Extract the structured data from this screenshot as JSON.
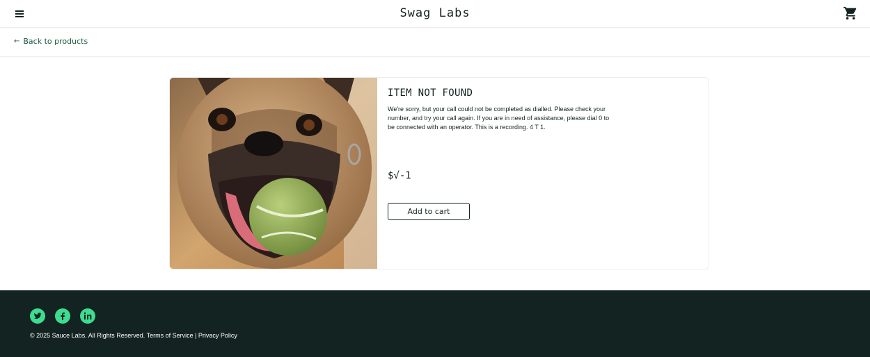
{
  "header": {
    "title": "Swag Labs",
    "menu_icon": "hamburger-menu-icon",
    "cart_icon": "shopping-cart-icon"
  },
  "secondary": {
    "back_label": "Back to products",
    "back_icon": "arrow-left-icon"
  },
  "item": {
    "name": "ITEM NOT FOUND",
    "description": "We're sorry, but your call could not be completed as dialled. Please check your number, and try your call again. If you are in need of assistance, please dial 0 to be connected with an operator. This is a recording. 4 T 1.",
    "price": "$√-1",
    "add_label": "Add to cart",
    "image_icon": "pug-with-tennis-ball-photo"
  },
  "footer": {
    "copyright": "© 2025 Sauce Labs. All Rights Reserved. Terms of Service | Privacy Policy",
    "social": [
      "twitter-icon",
      "facebook-icon",
      "linkedin-icon"
    ]
  },
  "colors": {
    "accent": "#3ddc91",
    "footer_bg": "#132322",
    "text": "#132322",
    "link": "#18583a"
  }
}
